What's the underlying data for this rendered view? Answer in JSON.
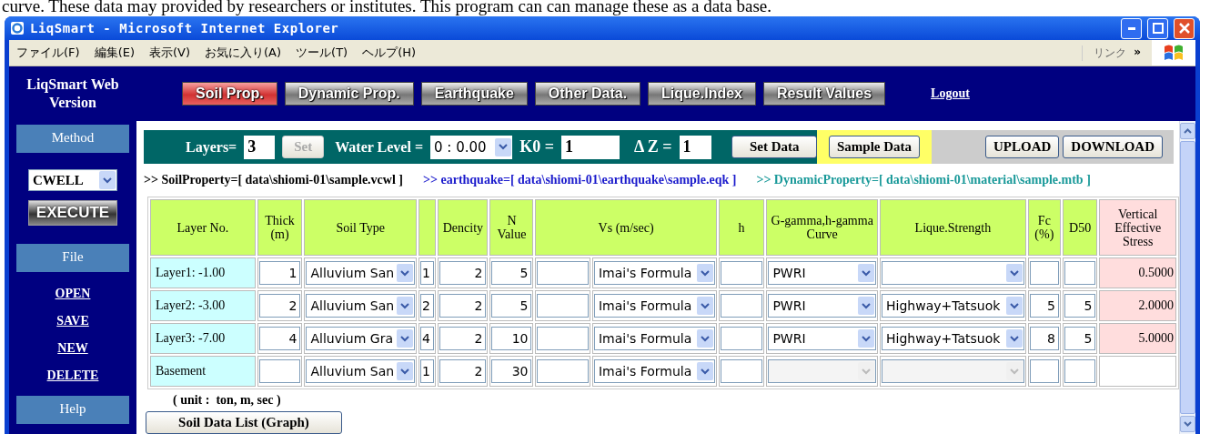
{
  "document_text": "curve. These data may provided by researchers or institutes. This program can can manage these as a data base.",
  "window": {
    "title": "LiqSmart - Microsoft Internet Explorer"
  },
  "menu_bar": {
    "items": [
      "ファイル(F)",
      "編集(E)",
      "表示(V)",
      "お気に入り(A)",
      "ツール(T)",
      "ヘルプ(H)"
    ],
    "links_label": "リンク",
    "links_chevron": "»"
  },
  "app_header": {
    "title": "LiqSmart Web Version",
    "tabs": [
      {
        "label": "Soil Prop.",
        "selected": true
      },
      {
        "label": "Dynamic Prop.",
        "selected": false
      },
      {
        "label": "Earthquake",
        "selected": false
      },
      {
        "label": "Other Data.",
        "selected": false
      },
      {
        "label": "Lique.Index",
        "selected": false
      },
      {
        "label": "Result Values",
        "selected": false
      }
    ],
    "logout": "Logout"
  },
  "sidebar": {
    "items": [
      {
        "kind": "header",
        "label": "Method"
      },
      {
        "kind": "select",
        "value": "CWELL"
      },
      {
        "kind": "button",
        "label": "EXECUTE"
      },
      {
        "kind": "header",
        "label": "File"
      },
      {
        "kind": "link",
        "label": "OPEN"
      },
      {
        "kind": "link",
        "label": "SAVE"
      },
      {
        "kind": "link",
        "label": "NEW"
      },
      {
        "kind": "link",
        "label": "DELETE"
      },
      {
        "kind": "header",
        "label": "Help"
      }
    ]
  },
  "toolbar": {
    "layers_label": "Layers=",
    "layers_value": "3",
    "set_button": {
      "label": "Set",
      "disabled": true
    },
    "water_level_label": "Water Level =",
    "water_level_value": "0 : 0.00",
    "k0_label": "K0 =",
    "k0_value": "1",
    "dz_label": "Δ Z =",
    "dz_value": "1",
    "set_data_button": "Set Data",
    "sample_data_button": "Sample Data",
    "upload_button": "UPLOAD",
    "download_button": "DOWNLOAD"
  },
  "file_paths": [
    {
      "text": ">> SoilProperty=[ data\\shiomi-01\\sample.vcwl ]",
      "color": "#000000"
    },
    {
      "text": ">> earthquake=[ data\\shiomi-01\\earthquake\\sample.eqk ]",
      "color": "#1a1acc"
    },
    {
      "text": ">> DynamicProperty=[ data\\shiomi-01\\material\\sample.mtb ]",
      "color": "#199999"
    }
  ],
  "table": {
    "columns": [
      {
        "kind": "text",
        "label": "Layer No."
      },
      {
        "kind": "text",
        "label": "Thick (m)"
      },
      {
        "kind": "text",
        "label": "Soil Type"
      },
      {
        "kind": "blank"
      },
      {
        "kind": "text",
        "label": "Dencity"
      },
      {
        "kind": "text",
        "label": "N Value"
      },
      {
        "kind": "wide",
        "label": "Vs (m/sec)"
      },
      {
        "kind": "text",
        "label": "h"
      },
      {
        "kind": "text",
        "label": "G-gamma,h-gamma Curve"
      },
      {
        "kind": "text",
        "label": "Lique.Strength"
      },
      {
        "kind": "text",
        "label": "Fc (%)"
      },
      {
        "kind": "text",
        "label": "D50"
      },
      {
        "kind": "stress",
        "label": "Vertical Effective Stress"
      }
    ],
    "rows": [
      {
        "layer": "Layer1: -1.00",
        "thick": "1",
        "soil_type": {
          "value": "Alluvium San",
          "disabled": false
        },
        "soil_index": "1",
        "dencity": "2",
        "n_value": "5",
        "vs_method": {
          "value": "Imai's Formula",
          "disabled": false
        },
        "g_curve": {
          "value": "PWRI",
          "disabled": false
        },
        "lique": {
          "disabled": false
        },
        "stress": "0.5000"
      },
      {
        "layer": "Layer2: -3.00",
        "thick": "2",
        "soil_type": {
          "value": "Alluvium San",
          "disabled": false
        },
        "soil_index": "2",
        "dencity": "2",
        "n_value": "5",
        "vs_method": {
          "value": "Imai's Formula",
          "disabled": false
        },
        "g_curve": {
          "value": "PWRI",
          "disabled": false
        },
        "lique": {
          "value": "Highway+Tatsuok",
          "disabled": false
        },
        "fc": "5",
        "d50": "5",
        "stress": "2.0000"
      },
      {
        "layer": "Layer3: -7.00",
        "thick": "4",
        "soil_type": {
          "value": "Alluvium Gra",
          "disabled": false
        },
        "soil_index": "4",
        "dencity": "2",
        "n_value": "10",
        "vs_method": {
          "value": "Imai's Formula",
          "disabled": false
        },
        "g_curve": {
          "value": "PWRI",
          "disabled": false
        },
        "lique": {
          "value": "Highway+Tatsuok",
          "disabled": false
        },
        "fc": "8",
        "d50": "5",
        "stress": "5.0000"
      },
      {
        "layer": "Basement",
        "soil_type": {
          "value": "Alluvium San",
          "disabled": false
        },
        "soil_index": "1",
        "dencity": "2",
        "n_value": "30",
        "vs_method": {
          "value": "Imai's Formula",
          "disabled": false
        },
        "g_curve": {
          "disabled": true
        },
        "lique": {
          "disabled": true
        }
      }
    ]
  },
  "unit_note": "( unit :  ton, m, sec )",
  "graph_button": "Soil Data List (Graph)"
}
